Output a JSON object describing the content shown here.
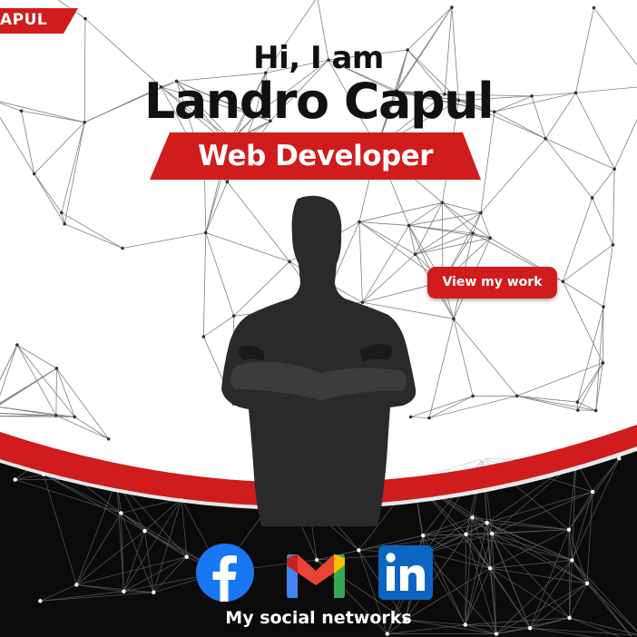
{
  "header": {
    "corner_tag": "APUL",
    "greeting": "Hi, I am",
    "name": "Landro Capul",
    "role": "Web Developer"
  },
  "cta": {
    "label": "View my work"
  },
  "social": {
    "caption": "My social networks",
    "links": [
      {
        "icon": "facebook-icon",
        "color": "#1877f2"
      },
      {
        "icon": "gmail-icon",
        "color": "#ea4335"
      },
      {
        "icon": "linkedin-icon",
        "color": "#0a66c2"
      }
    ]
  },
  "colors": {
    "accent_red": "#d01c1c",
    "dark": "#0b0b0b",
    "text": "#111111",
    "white": "#ffffff"
  }
}
